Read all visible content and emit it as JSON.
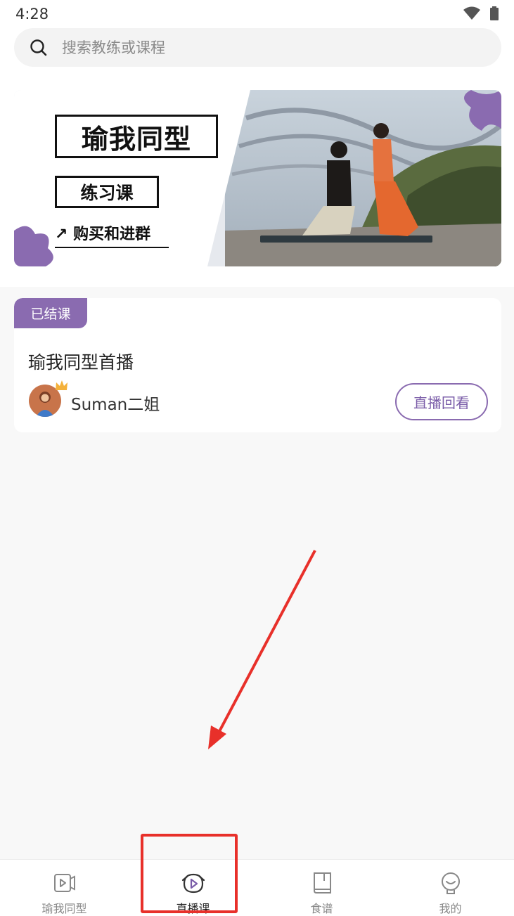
{
  "status": {
    "time": "4:28"
  },
  "search": {
    "placeholder": "搜索教练或课程"
  },
  "banner": {
    "title": "瑜我同型",
    "subtitle": "练习课",
    "link": "↗ 购买和进群"
  },
  "live_card": {
    "badge": "已结课",
    "title": "瑜我同型首播",
    "coach": "Suman二姐",
    "button": "直播回看"
  },
  "tabs": [
    {
      "label": "瑜我同型",
      "icon": "video-icon"
    },
    {
      "label": "直播课",
      "icon": "live-play-icon"
    },
    {
      "label": "食谱",
      "icon": "book-icon"
    },
    {
      "label": "我的",
      "icon": "profile-icon"
    }
  ],
  "active_tab": "直播课",
  "colors": {
    "accent": "#8a6bb0",
    "annotation": "#e8302a"
  }
}
